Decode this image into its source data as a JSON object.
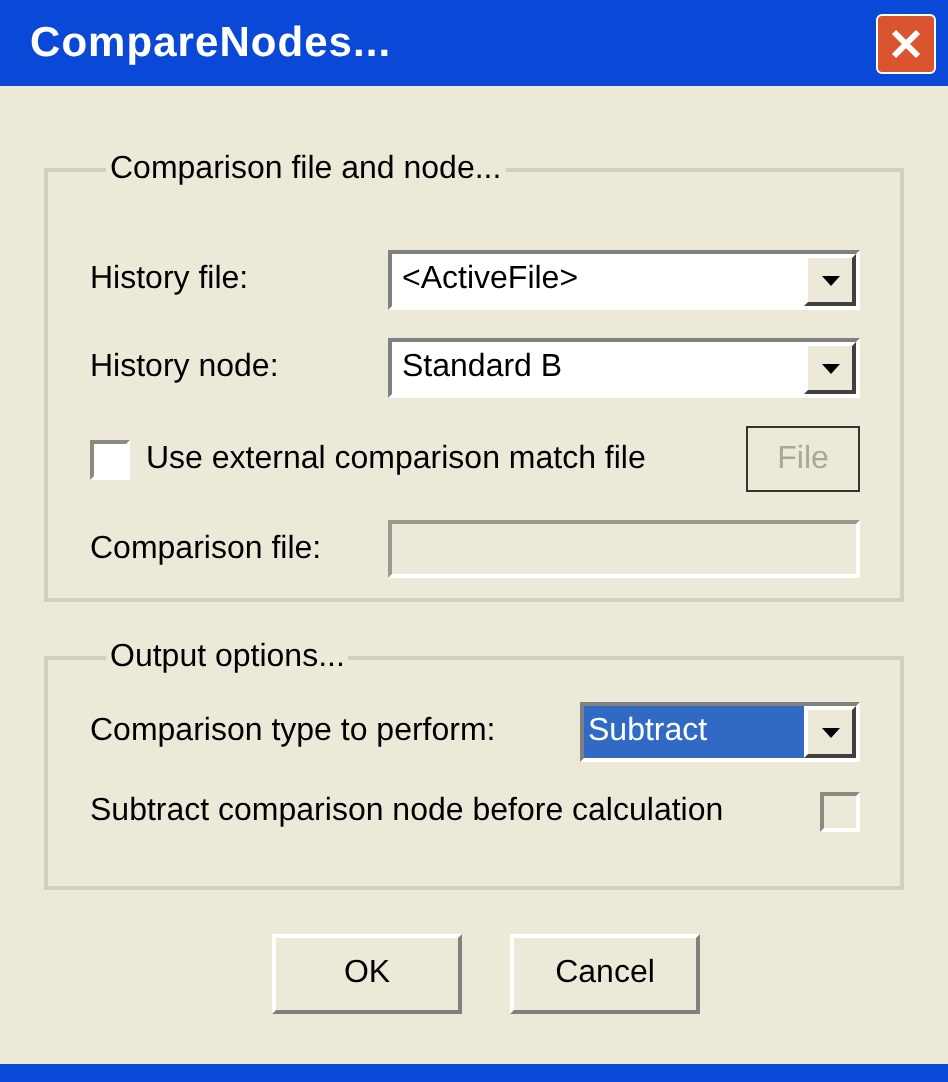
{
  "window": {
    "title": "CompareNodes..."
  },
  "comparison_group": {
    "title": "Comparison file and node...",
    "history_file": {
      "label": "History file:",
      "value": "<ActiveFile>"
    },
    "history_node": {
      "label": "History node:",
      "value": "Standard B"
    },
    "external_match": {
      "label": "Use external comparison match file",
      "checked": false,
      "disabled": false
    },
    "file_button": {
      "label": "File",
      "disabled": true
    },
    "comparison_file": {
      "label": "Comparison file:",
      "disabled": true
    }
  },
  "output_group": {
    "title": "Output options...",
    "comparison_type": {
      "label": "Comparison type to perform:",
      "value": "Subtract",
      "focused": true
    },
    "subtract_before": {
      "label": "Subtract comparison node before calculation",
      "checked": false,
      "disabled": true
    }
  },
  "buttons": [
    {
      "label": "OK"
    },
    {
      "label": "Cancel"
    }
  ]
}
